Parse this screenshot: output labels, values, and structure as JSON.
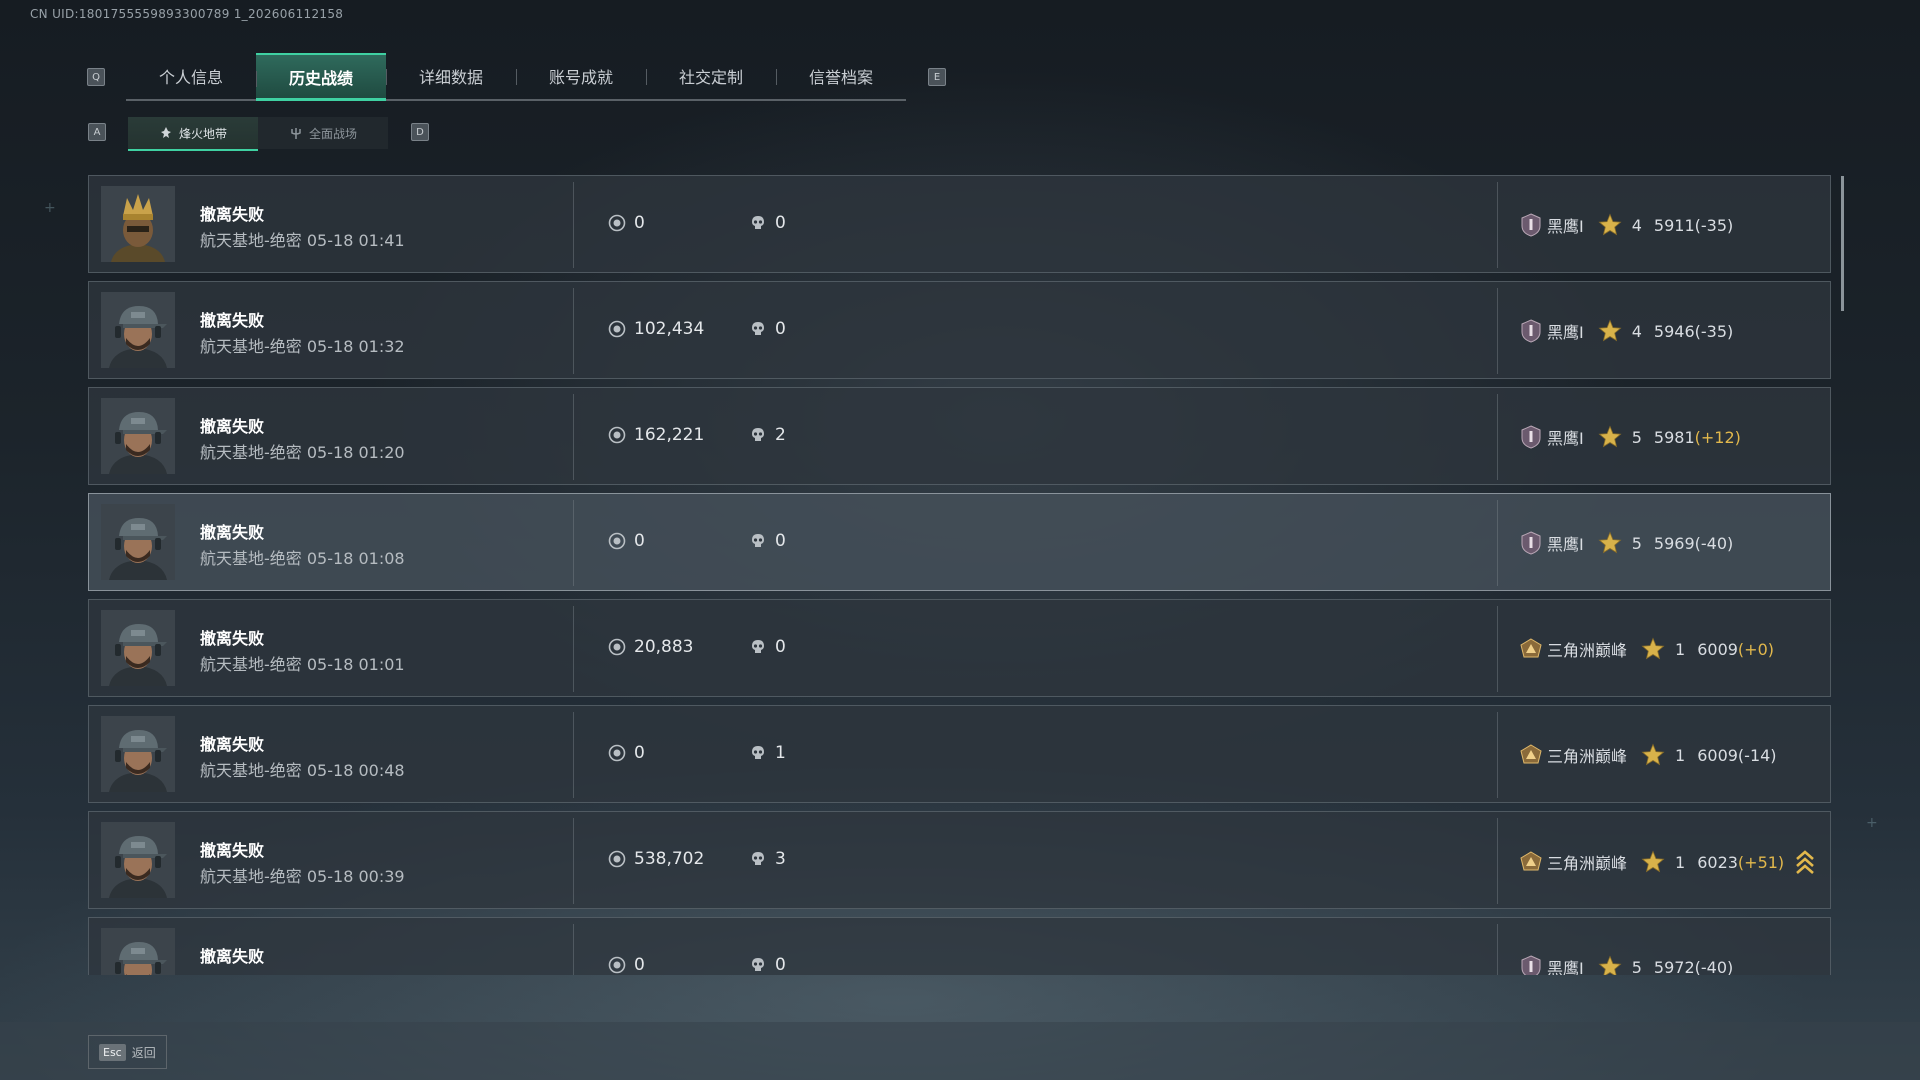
{
  "uid_text": "CN UID:1801755559893300789 1_202606112158",
  "keyhints": {
    "q": "Q",
    "e": "E",
    "a": "A",
    "d": "D"
  },
  "tabs": [
    {
      "label": "个人信息"
    },
    {
      "label": "历史战绩"
    },
    {
      "label": "详细数据"
    },
    {
      "label": "账号成就"
    },
    {
      "label": "社交定制"
    },
    {
      "label": "信誉档案"
    }
  ],
  "subtabs": [
    {
      "label": "烽火地带",
      "icon": "flame-icon"
    },
    {
      "label": "全面战场",
      "icon": "trident-icon"
    }
  ],
  "records": [
    {
      "result": "撤离失败",
      "map": "航天基地-绝密",
      "time": "05-18 01:41",
      "value": "0",
      "kills": "0",
      "rank": "黑鹰I",
      "stars": "4",
      "score": "5911",
      "delta": "(-35)",
      "delta_type": "neg",
      "avatar": "soldier-crown"
    },
    {
      "result": "撤离失败",
      "map": "航天基地-绝密",
      "time": "05-18 01:32",
      "value": "102,434",
      "kills": "0",
      "rank": "黑鹰I",
      "stars": "4",
      "score": "5946",
      "delta": "(-35)",
      "delta_type": "neg",
      "avatar": "soldier-cap"
    },
    {
      "result": "撤离失败",
      "map": "航天基地-绝密",
      "time": "05-18 01:20",
      "value": "162,221",
      "kills": "2",
      "rank": "黑鹰I",
      "stars": "5",
      "score": "5981",
      "delta": "(+12)",
      "delta_type": "pos",
      "avatar": "soldier-cap"
    },
    {
      "result": "撤离失败",
      "map": "航天基地-绝密",
      "time": "05-18 01:08",
      "value": "0",
      "kills": "0",
      "rank": "黑鹰I",
      "stars": "5",
      "score": "5969",
      "delta": "(-40)",
      "delta_type": "neg",
      "avatar": "soldier-cap"
    },
    {
      "result": "撤离失败",
      "map": "航天基地-绝密",
      "time": "05-18 01:01",
      "value": "20,883",
      "kills": "0",
      "rank": "三角洲巅峰",
      "stars": "1",
      "score": "6009",
      "delta": "(+0)",
      "delta_type": "pos",
      "avatar": "soldier-cap"
    },
    {
      "result": "撤离失败",
      "map": "航天基地-绝密",
      "time": "05-18 00:48",
      "value": "0",
      "kills": "1",
      "rank": "三角洲巅峰",
      "stars": "1",
      "score": "6009",
      "delta": "(-14)",
      "delta_type": "neg",
      "avatar": "soldier-cap"
    },
    {
      "result": "撤离失败",
      "map": "航天基地-绝密",
      "time": "05-18 00:39",
      "value": "538,702",
      "kills": "3",
      "rank": "三角洲巅峰",
      "stars": "1",
      "score": "6023",
      "delta": "(+51)",
      "delta_type": "pos",
      "avatar": "soldier-cap",
      "rank_up": true
    },
    {
      "result": "撤离失败",
      "map": "",
      "time": "",
      "value": "0",
      "kills": "0",
      "rank": "黑鹰I",
      "stars": "5",
      "score": "5972",
      "delta": "(-40)",
      "delta_type": "neg",
      "avatar": "soldier-cap"
    }
  ],
  "footer": {
    "esc_key": "Esc",
    "back_label": "返回"
  },
  "colors": {
    "accent": "#3fd1a2",
    "gold": "#e2b84c"
  }
}
